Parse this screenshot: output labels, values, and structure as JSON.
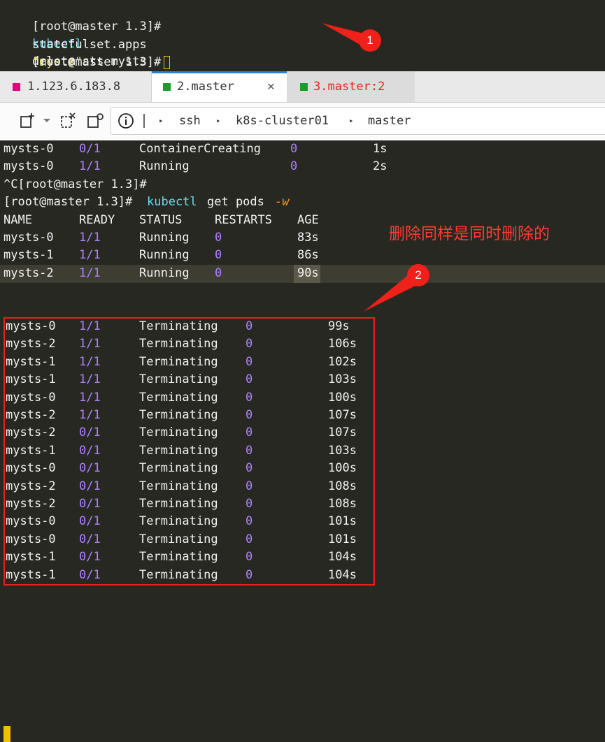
{
  "top_terminal": {
    "line1": {
      "prompt": "[root@master 1.3]#",
      "cmd": "kubectl",
      "args": "delete sts mysts"
    },
    "line2": {
      "pre": "statefulset.apps",
      "name": "\"mysts\"",
      "post": "deleted"
    },
    "line3": {
      "prompt": "[root@master 1.3]#"
    }
  },
  "tabs": [
    {
      "label": "1.123.6.183.8",
      "color": "#e6007e"
    },
    {
      "label": "2.master",
      "color": "#1a9d2e",
      "close": "✕"
    },
    {
      "label": "3.master:2",
      "color": "#1a9d2e",
      "text_color": "#e8221b"
    }
  ],
  "toolbar": {
    "info": "i",
    "breadcrumb": [
      "ssh",
      "k8s-cluster01",
      "master"
    ],
    "arrow": "▸"
  },
  "main_terminal": {
    "pre_lines": [
      [
        "mysts-0",
        "0/1",
        "ContainerCreating",
        "0",
        "1s"
      ],
      [
        "mysts-0",
        "1/1",
        "Running",
        "0",
        "2s"
      ]
    ],
    "ctrl_c_line": "^C[root@master 1.3]#",
    "get_line": {
      "prompt": "[root@master 1.3]#",
      "cmd": "kubectl",
      "args": "get pods",
      "flag": "-w"
    },
    "headers": [
      "NAME",
      "READY",
      "STATUS",
      "RESTARTS",
      "AGE"
    ],
    "running": [
      [
        "mysts-0",
        "1/1",
        "Running",
        "0",
        "83s"
      ],
      [
        "mysts-1",
        "1/1",
        "Running",
        "0",
        "86s"
      ],
      [
        "mysts-2",
        "1/1",
        "Running",
        "0",
        "90s"
      ]
    ],
    "terminating": [
      [
        "mysts-0",
        "1/1",
        "Terminating",
        "0",
        "99s"
      ],
      [
        "mysts-2",
        "1/1",
        "Terminating",
        "0",
        "106s"
      ],
      [
        "mysts-1",
        "1/1",
        "Terminating",
        "0",
        "102s"
      ],
      [
        "mysts-1",
        "1/1",
        "Terminating",
        "0",
        "103s"
      ],
      [
        "mysts-0",
        "1/1",
        "Terminating",
        "0",
        "100s"
      ],
      [
        "mysts-2",
        "1/1",
        "Terminating",
        "0",
        "107s"
      ],
      [
        "mysts-2",
        "0/1",
        "Terminating",
        "0",
        "107s"
      ],
      [
        "mysts-1",
        "0/1",
        "Terminating",
        "0",
        "103s"
      ],
      [
        "mysts-0",
        "0/1",
        "Terminating",
        "0",
        "100s"
      ],
      [
        "mysts-2",
        "0/1",
        "Terminating",
        "0",
        "108s"
      ],
      [
        "mysts-2",
        "0/1",
        "Terminating",
        "0",
        "108s"
      ],
      [
        "mysts-0",
        "0/1",
        "Terminating",
        "0",
        "101s"
      ],
      [
        "mysts-0",
        "0/1",
        "Terminating",
        "0",
        "101s"
      ],
      [
        "mysts-1",
        "0/1",
        "Terminating",
        "0",
        "104s"
      ],
      [
        "mysts-1",
        "0/1",
        "Terminating",
        "0",
        "104s"
      ]
    ]
  },
  "annotations": {
    "note": "删除同样是同时删除的",
    "badge1": "1",
    "badge2": "2",
    "color": "#e8221b"
  }
}
